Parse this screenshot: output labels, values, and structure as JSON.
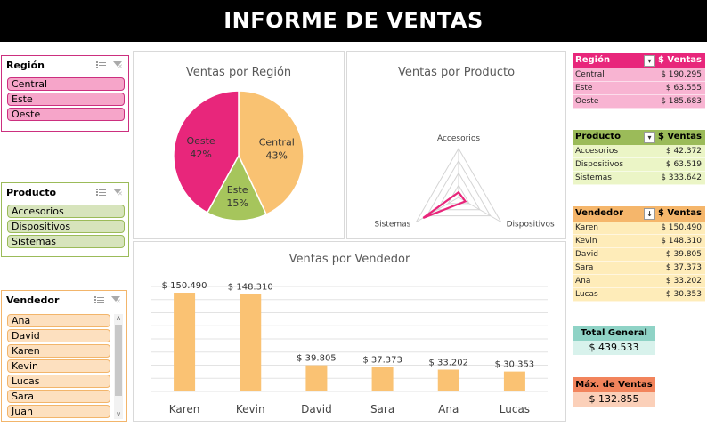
{
  "banner": {
    "title": "INFORME DE VENTAS"
  },
  "slicers": {
    "region": {
      "title": "Región",
      "items": [
        "Central",
        "Este",
        "Oeste"
      ],
      "accent": "#cc2f7f",
      "item_fill": "#f6a5c9"
    },
    "product": {
      "title": "Producto",
      "items": [
        "Accesorios",
        "Dispositivos",
        "Sistemas"
      ],
      "accent": "#9bbb59",
      "item_fill": "#d7e4bc"
    },
    "seller": {
      "title": "Vendedor",
      "items": [
        "Ana",
        "David",
        "Karen",
        "Kevin",
        "Lucas",
        "Sara",
        "Juan"
      ],
      "accent": "#f2b56b",
      "item_fill": "#fde0bf"
    }
  },
  "charts": {
    "region": {
      "title": "Ventas por Región"
    },
    "product": {
      "title": "Ventas por Producto"
    },
    "seller": {
      "title": "Ventas por Vendedor"
    }
  },
  "chart_data": [
    {
      "type": "pie",
      "title": "Ventas por Región",
      "categories": [
        "Central",
        "Este",
        "Oeste"
      ],
      "values": [
        43,
        15,
        42
      ],
      "labels": [
        "43%",
        "15%",
        "42%"
      ],
      "colors": [
        "#f9c272",
        "#a6c55c",
        "#e8267b"
      ]
    },
    {
      "type": "radar",
      "title": "Ventas por Producto",
      "categories": [
        "Accesorios",
        "Dispositivos",
        "Sistemas"
      ],
      "values": [
        42372,
        63519,
        333642
      ],
      "color": "#e8267b"
    },
    {
      "type": "bar",
      "title": "Ventas por Vendedor",
      "categories": [
        "Karen",
        "Kevin",
        "David",
        "Sara",
        "Ana",
        "Lucas"
      ],
      "values": [
        150490,
        148310,
        39805,
        37373,
        33202,
        30353
      ],
      "labels": [
        "$ 150.490",
        "$ 148.310",
        "$ 39.805",
        "$ 37.373",
        "$ 33.202",
        "$ 30.353"
      ],
      "color": "#fac273"
    }
  ],
  "tables": {
    "region": {
      "h1": "Región",
      "h2": "$ Ventas",
      "dd": "▾",
      "rows": [
        [
          "Central",
          "$ 190.295"
        ],
        [
          "Este",
          "$ 63.555"
        ],
        [
          "Oeste",
          "$ 185.683"
        ]
      ],
      "head_color": "#e8267b",
      "body_color": "#f8b4d2",
      "head_text": "#ffffff"
    },
    "product": {
      "h1": "Producto",
      "h2": "$ Ventas",
      "dd": "▾",
      "rows": [
        [
          "Accesorios",
          "$ 42.372"
        ],
        [
          "Dispositivos",
          "$ 63.519"
        ],
        [
          "Sistemas",
          "$ 333.642"
        ]
      ],
      "head_color": "#9bbb59",
      "body_color": "#ebf5c6",
      "head_text": "#000000"
    },
    "seller": {
      "h1": "Vendedor",
      "h2": "$ Ventas",
      "dd": "↓",
      "rows": [
        [
          "Karen",
          "$ 150.490"
        ],
        [
          "Kevin",
          "$ 148.310"
        ],
        [
          "David",
          "$ 39.805"
        ],
        [
          "Sara",
          "$ 37.373"
        ],
        [
          "Ana",
          "$ 33.202"
        ],
        [
          "Lucas",
          "$ 30.353"
        ]
      ],
      "head_color": "#f5b66b",
      "body_color": "#feecb9",
      "head_text": "#000000"
    }
  },
  "kpis": {
    "total": {
      "label": "Total General",
      "value": "$ 439.533",
      "head_color": "#8fd3c6",
      "body_color": "#d8f2ec"
    },
    "max": {
      "label": "Máx. de Ventas",
      "value": "$ 132.855",
      "head_color": "#f2845c",
      "body_color": "#fbd0b9"
    }
  }
}
